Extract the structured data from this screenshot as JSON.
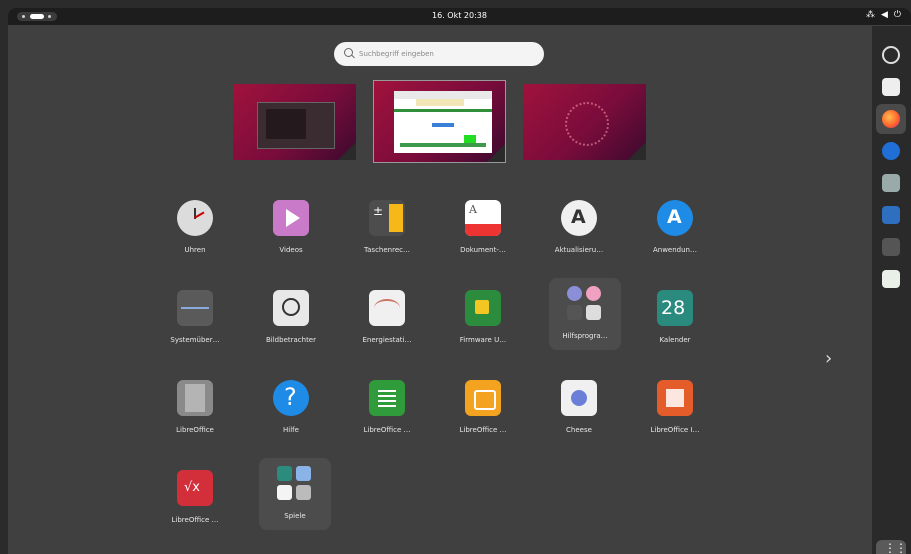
{
  "topbar": {
    "datetime": "16. Okt  20:38"
  },
  "search": {
    "placeholder": "Suchbegriff eingeben"
  },
  "apps": [
    {
      "label": "Uhren",
      "icon": "clocks-icon"
    },
    {
      "label": "Videos",
      "icon": "videos-icon"
    },
    {
      "label": "Taschenrec…",
      "icon": "calculator-icon"
    },
    {
      "label": "Dokument-…",
      "icon": "document-viewer-icon"
    },
    {
      "label": "Aktualisieru…",
      "icon": "software-updater-icon"
    },
    {
      "label": "Anwendun…",
      "icon": "app-center-icon"
    },
    {
      "label": "Systemüber…",
      "icon": "system-monitor-icon"
    },
    {
      "label": "Bildbetrachter",
      "icon": "image-viewer-icon"
    },
    {
      "label": "Energiestati…",
      "icon": "power-statistics-icon"
    },
    {
      "label": "Firmware U…",
      "icon": "firmware-updater-icon"
    },
    {
      "label": "Hilfsprogra…",
      "icon": "utilities-folder-icon"
    },
    {
      "label": "Kalender",
      "icon": "calendar-icon"
    },
    {
      "label": "LibreOffice",
      "icon": "libreoffice-icon"
    },
    {
      "label": "Hilfe",
      "icon": "help-icon"
    },
    {
      "label": "LibreOffice …",
      "icon": "libreoffice-calc-icon"
    },
    {
      "label": "LibreOffice …",
      "icon": "libreoffice-draw-icon"
    },
    {
      "label": "Cheese",
      "icon": "cheese-icon"
    },
    {
      "label": "LibreOffice I…",
      "icon": "libreoffice-impress-icon"
    },
    {
      "label": "LibreOffice …",
      "icon": "libreoffice-math-icon"
    },
    {
      "label": "Spiele",
      "icon": "games-folder-icon"
    }
  ],
  "calendar_day": "28",
  "dock": [
    {
      "icon": "settings-icon"
    },
    {
      "icon": "toggle-app-icon"
    },
    {
      "icon": "firefox-icon"
    },
    {
      "icon": "thunderbird-icon"
    },
    {
      "icon": "files-icon"
    },
    {
      "icon": "text-editor-icon"
    },
    {
      "icon": "terminal-icon"
    },
    {
      "icon": "trash-icon"
    },
    {
      "icon": "show-apps-icon"
    }
  ],
  "colors": {
    "accent": "#e95420",
    "wallpaper": "#a0123c",
    "background": "#404040"
  }
}
